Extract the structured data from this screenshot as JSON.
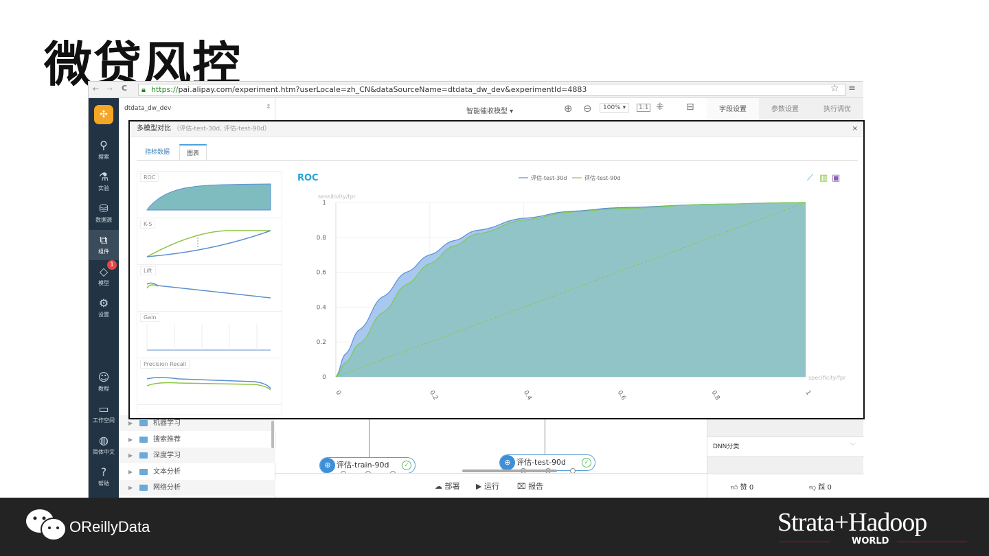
{
  "slide": {
    "title": "微贷风控"
  },
  "browser": {
    "url_scheme": "https://",
    "url_rest": "pai.alipay.com/experiment.htm?userLocale=zh_CN&dataSourceName=dtdata_dw_dev&experimentId=4883"
  },
  "nav": {
    "items": [
      {
        "label": "搜索",
        "icon": "search-icon"
      },
      {
        "label": "实验",
        "icon": "flask-icon"
      },
      {
        "label": "数据源",
        "icon": "database-icon"
      },
      {
        "label": "组件",
        "icon": "puzzle-icon",
        "active": true
      },
      {
        "label": "模型",
        "icon": "diamond-icon",
        "badge": "1"
      },
      {
        "label": "设置",
        "icon": "gear-icon"
      },
      {
        "label": "教程",
        "icon": "tutorial-icon"
      },
      {
        "label": "工作空间",
        "icon": "workspace-icon"
      },
      {
        "label": "简体中文",
        "icon": "globe-icon"
      },
      {
        "label": "帮助",
        "icon": "help-icon"
      }
    ]
  },
  "listpane": {
    "workspace": "dtdata_dw_dev",
    "folders": [
      "机器学习",
      "搜索推荐",
      "深度学习",
      "文本分析",
      "网络分析"
    ]
  },
  "toolbar": {
    "experiment": "智能催收模型",
    "zoom": "100%",
    "tabs": [
      "字段设置",
      "参数设置",
      "执行调优"
    ]
  },
  "canvas": {
    "nodes": [
      "评估-train-90d",
      "评估-test-90d"
    ]
  },
  "bottombar": {
    "deploy": "部署",
    "run": "运行",
    "report": "报告"
  },
  "rightpane": {
    "select_value": "DNN分类",
    "like": "赞 0",
    "dislike": "踩 0"
  },
  "modal": {
    "title": "多模型对比",
    "subtitle": "（评估-test-30d, 评估-test-90d）",
    "close": "×",
    "tabs": [
      "指标数据",
      "图表"
    ],
    "active_tab": "图表",
    "thumbnails": [
      "ROC",
      "K-S",
      "Lift",
      "Gain",
      "Precision Recall"
    ]
  },
  "chart_data": {
    "type": "area",
    "title": "ROC",
    "ylabel": "sensitivity/tpr",
    "xlabel": "specificity/fpr",
    "xlim": [
      0,
      1
    ],
    "ylim": [
      0,
      1
    ],
    "xticks": [
      "0",
      "0.2",
      "0.4",
      "0.6",
      "0.8",
      "1"
    ],
    "yticks": [
      "0",
      "0.2",
      "0.4",
      "0.6",
      "0.8",
      "1"
    ],
    "grid": true,
    "legend": "top-center",
    "x": [
      0,
      0.02,
      0.05,
      0.1,
      0.15,
      0.2,
      0.25,
      0.3,
      0.4,
      0.5,
      0.6,
      0.8,
      1
    ],
    "series": [
      {
        "name": "评估-test-30d",
        "color": "#5b8fd0",
        "values": [
          0,
          0.13,
          0.27,
          0.46,
          0.6,
          0.7,
          0.78,
          0.84,
          0.91,
          0.95,
          0.97,
          0.99,
          1
        ]
      },
      {
        "name": "评估-test-90d",
        "color": "#7cc95a",
        "values": [
          0,
          0.08,
          0.19,
          0.37,
          0.53,
          0.65,
          0.75,
          0.82,
          0.9,
          0.945,
          0.965,
          0.99,
          1
        ]
      }
    ],
    "diagonal": true
  },
  "footer": {
    "wechat": "OReillyData",
    "brand": "Strata+Hadoop",
    "brand_sub": "WORLD"
  }
}
